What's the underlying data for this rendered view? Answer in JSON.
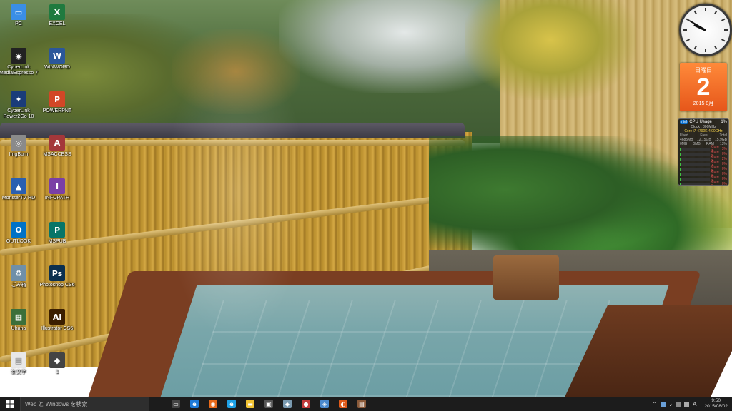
{
  "desktop_icons": [
    {
      "id": "pc",
      "label": "PC",
      "color": "#3a8ee6",
      "glyph": "▭"
    },
    {
      "id": "excel",
      "label": "EXCEL",
      "color": "#1f7a3f",
      "glyph": "X"
    },
    {
      "id": "cyberlink-me",
      "label": "CyberLink\nMediaEspresso 7",
      "color": "#222",
      "glyph": "◉"
    },
    {
      "id": "winword",
      "label": "WINWORD",
      "color": "#2b579a",
      "glyph": "W"
    },
    {
      "id": "cyberlink-p2g",
      "label": "CyberLink\nPower2Go 10",
      "color": "#1a3c7a",
      "glyph": "✦"
    },
    {
      "id": "powerpnt",
      "label": "POWERPNT",
      "color": "#d24726",
      "glyph": "P"
    },
    {
      "id": "imgburn",
      "label": "ImgBurn",
      "color": "#8a8a8a",
      "glyph": "◎"
    },
    {
      "id": "msaccess",
      "label": "MSACCESS",
      "color": "#a4373a",
      "glyph": "A"
    },
    {
      "id": "monstertv",
      "label": "MonsterTV HD",
      "color": "#2a5fb0",
      "glyph": "▲"
    },
    {
      "id": "infopath",
      "label": "INFOPATH",
      "color": "#7a3fa6",
      "glyph": "I"
    },
    {
      "id": "outlook",
      "label": "OUTLOOK",
      "color": "#0072c6",
      "glyph": "O"
    },
    {
      "id": "mspub",
      "label": "MSPUB",
      "color": "#077568",
      "glyph": "P"
    },
    {
      "id": "recycle",
      "label": "ごみ箱",
      "color": "#6f8fa8",
      "glyph": "♻"
    },
    {
      "id": "photoshop",
      "label": "Photoshop CS6",
      "color": "#0b2f4f",
      "glyph": "Ps"
    },
    {
      "id": "uhana",
      "label": "Uhana",
      "color": "#3b6f3a",
      "glyph": "▦"
    },
    {
      "id": "illustrator",
      "label": "Illustrator CS6",
      "color": "#3b1f00",
      "glyph": "Ai"
    },
    {
      "id": "textfile",
      "label": "新文字",
      "color": "#e8e8e8",
      "glyph": "▤"
    },
    {
      "id": "shortcut1",
      "label": "1",
      "color": "#444",
      "glyph": "◆"
    }
  ],
  "clock_gadget": {
    "hour": 9,
    "minute": 50
  },
  "calendar_gadget": {
    "weekday": "日曜日",
    "day": "2",
    "year_month": "2015 8月"
  },
  "cpu_gadget": {
    "title": "CPU Usage",
    "percent": "1%",
    "clock": "Clock : 800MHz",
    "model": "Core i7-4790K 4.00GHz",
    "mem_headers": [
      "Used",
      "Free",
      "Total"
    ],
    "mem_values": [
      "4685MB",
      "12.15GB",
      "15.9GB"
    ],
    "swap_values": [
      "0MB",
      "0MB",
      "RAM",
      "13%"
    ],
    "cores": [
      {
        "name": "Core 1",
        "value": "3%",
        "level": 0.03
      },
      {
        "name": "Core 2",
        "value": "0%",
        "level": 0.0
      },
      {
        "name": "Core 3",
        "value": "2%",
        "level": 0.02
      },
      {
        "name": "Core 4",
        "value": "0%",
        "level": 0.0
      },
      {
        "name": "Core 5",
        "value": "0%",
        "level": 0.0
      },
      {
        "name": "Core 6",
        "value": "0%",
        "level": 0.0
      },
      {
        "name": "Core 7",
        "value": "0%",
        "level": 0.0
      },
      {
        "name": "Core 8",
        "value": "0%",
        "level": 0.0
      }
    ]
  },
  "taskbar": {
    "search_placeholder": "Web と Windows を検索",
    "pinned": [
      {
        "name": "task-view",
        "color": "#444",
        "glyph": "▭"
      },
      {
        "name": "edge",
        "color": "#1e7ad8",
        "glyph": "e"
      },
      {
        "name": "firefox",
        "color": "#e86a1a",
        "glyph": "◉"
      },
      {
        "name": "ie",
        "color": "#1ea1e6",
        "glyph": "e"
      },
      {
        "name": "explorer",
        "color": "#f1c232",
        "glyph": "▬"
      },
      {
        "name": "store",
        "color": "#555",
        "glyph": "▣"
      },
      {
        "name": "app-a",
        "color": "#7a9ab0",
        "glyph": "◆"
      },
      {
        "name": "app-b",
        "color": "#c23b3b",
        "glyph": "●"
      },
      {
        "name": "app-c",
        "color": "#4a8ad0",
        "glyph": "◈"
      },
      {
        "name": "app-d",
        "color": "#e05a1a",
        "glyph": "◐"
      },
      {
        "name": "app-e",
        "color": "#8a5a3a",
        "glyph": "▤"
      }
    ],
    "tray_ime": "A",
    "time": "9:50",
    "date": "2015/08/02"
  }
}
